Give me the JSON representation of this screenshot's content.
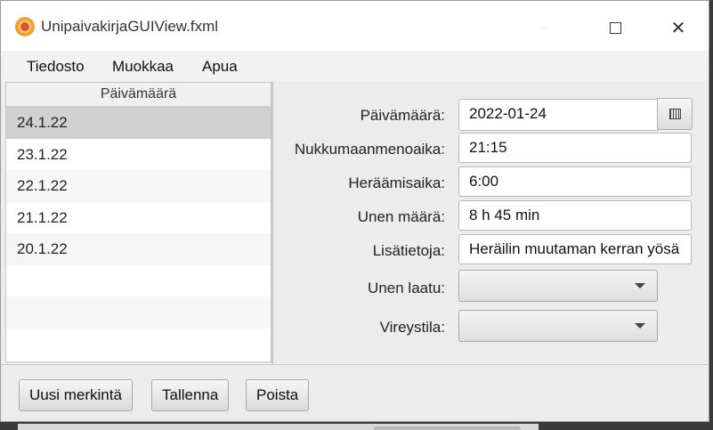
{
  "window": {
    "title": "UnipaivakirjaGUIView.fxml",
    "icon": "app-logo-icon",
    "controls": [
      "minimize-icon",
      "maximize-icon",
      "close-icon"
    ]
  },
  "menu": {
    "items": [
      "Tiedosto",
      "Muokkaa",
      "Apua"
    ]
  },
  "list": {
    "header": "Päivämäärä",
    "rows": [
      "24.1.22",
      "23.1.22",
      "22.1.22",
      "21.1.22",
      "20.1.22"
    ],
    "selected_index": 0
  },
  "form": {
    "date": {
      "label": "Päivämäärä:",
      "value": "2022-01-24"
    },
    "bedtime": {
      "label": "Nukkumaanmenoaika:",
      "value": "21:15"
    },
    "waketime": {
      "label": "Heräämisaika:",
      "value": "6:00"
    },
    "sleep_amount": {
      "label": "Unen määrä:",
      "value": "8 h 45 min"
    },
    "notes": {
      "label": "Lisätietoja:",
      "value": "Heräilin muutaman kerran yösä"
    },
    "sleep_quality": {
      "label": "Unen laatu:",
      "value": ""
    },
    "alertness": {
      "label": "Vireystila:",
      "value": ""
    }
  },
  "buttons": {
    "new_entry": "Uusi merkintä",
    "save": "Tallenna",
    "delete": "Poista"
  }
}
